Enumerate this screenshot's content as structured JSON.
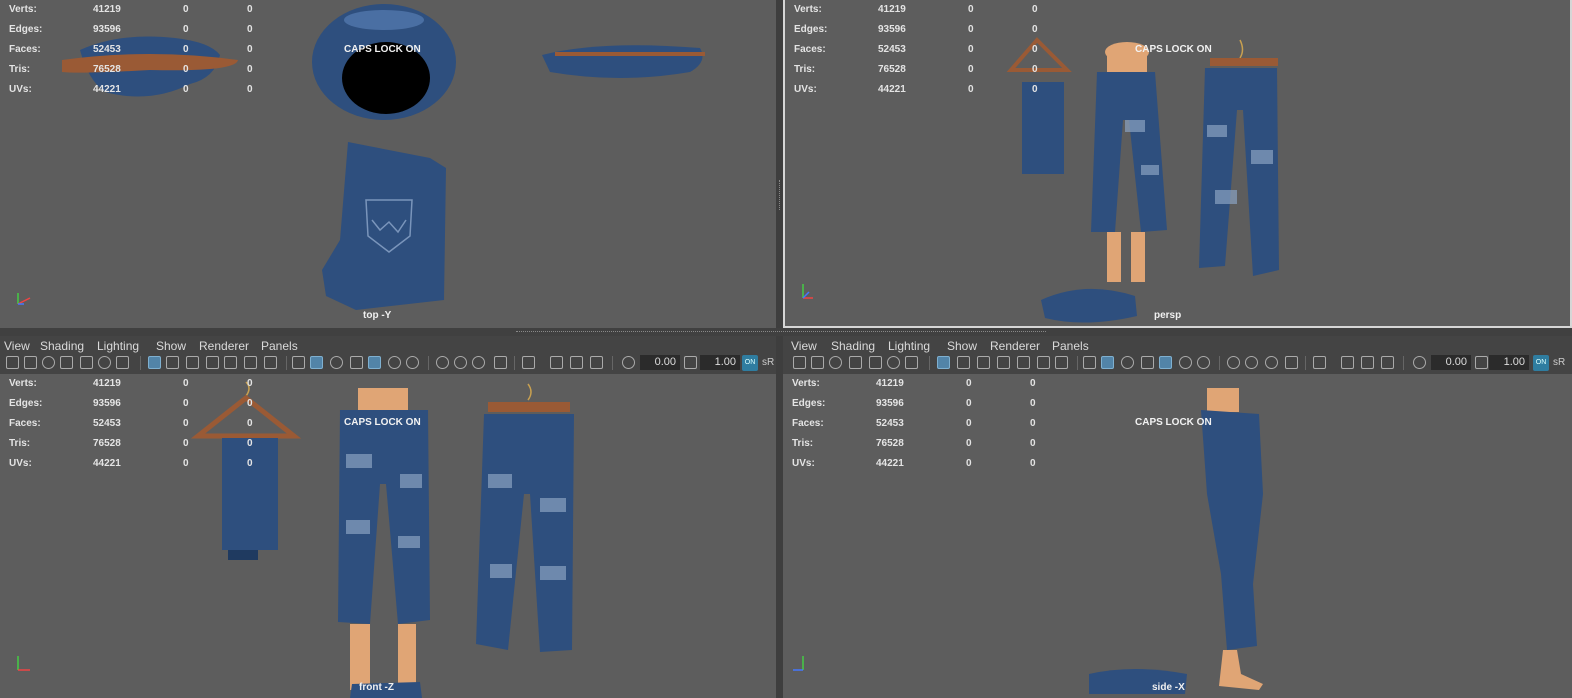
{
  "hud": {
    "rows": [
      {
        "label": "Verts:",
        "value": "41219",
        "a": "0",
        "b": "0"
      },
      {
        "label": "Edges:",
        "value": "93596",
        "a": "0",
        "b": "0"
      },
      {
        "label": "Faces:",
        "value": "52453",
        "a": "0",
        "b": "0"
      },
      {
        "label": "Tris:",
        "value": "76528",
        "a": "0",
        "b": "0"
      },
      {
        "label": "UVs:",
        "value": "44221",
        "a": "0",
        "b": "0"
      }
    ]
  },
  "caps_lock_text": "CAPS LOCK ON",
  "cameras": {
    "top": "top -Y",
    "persp": "persp",
    "front": "front -Z",
    "side": "side -X"
  },
  "menu": {
    "view": "View",
    "shading": "Shading",
    "lighting": "Lighting",
    "show": "Show",
    "renderer": "Renderer",
    "panels": "Panels"
  },
  "toolbar": {
    "exposure": "0.00",
    "gamma": "1.00",
    "color_mgmt_badge": "ON",
    "color_space": "sR"
  },
  "axis": {
    "x": "x",
    "y": "y",
    "z": "z"
  },
  "colors": {
    "viewport_bg": "#5d5d5d",
    "panel_bg": "#444444",
    "denim": "#2e4f7e",
    "denim_light": "#4a6fa3",
    "hanger_wood": "#9a5a35",
    "skin": "#e0a575",
    "active_icon": "#5284a8"
  }
}
